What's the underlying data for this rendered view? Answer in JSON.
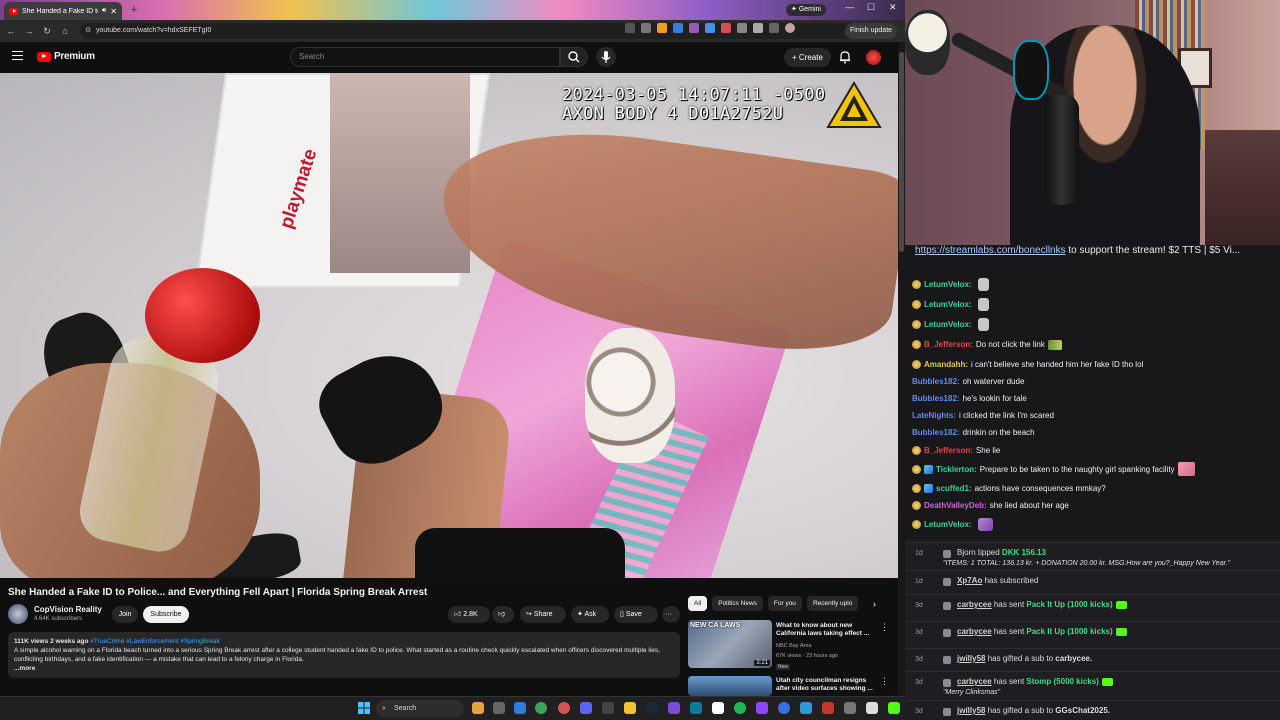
{
  "browser": {
    "tab_title": "She Handed a Fake ID to Po",
    "gemini_label": "Gemini",
    "url": "youtube.com/watch?v=hdxSEFETgI0",
    "finish_update_label": "Finish update"
  },
  "youtube": {
    "logo_text": "Premium",
    "search_placeholder": "Search",
    "create_label": "Create",
    "bodycam_timestamp": "2024-03-05 14:07:11 -0500",
    "bodycam_device": "AXON BODY 4 D01A2752U",
    "cooler_brand": "playmate",
    "video_title": "She Handed a Fake ID to Police... and Everything Fell Apart | Florida Spring Break Arrest",
    "channel_name": "CopVision Reality",
    "channel_subs": "4.64K subscribers",
    "join_label": "Join",
    "subscribe_label": "Subscribe",
    "like_count": "2.8K",
    "share_label": "Share",
    "ask_label": "Ask",
    "save_label": "Save",
    "more_actions": "···",
    "description": {
      "meta": "111K views  2 weeks ago ",
      "tags": "#TrueCrime #LawEnforcement #SpringBreak",
      "body": "A simple alcohol warning on a Florida beach turned into a serious Spring Break arrest after a college student handed a fake ID to police. What started as a routine check quickly escalated when officers discovered multiple lies, conflicting birthdays, and a fake identification — a mistake that can lead to a felony charge in Florida.",
      "more": "...more"
    },
    "chips": [
      "All",
      "Politics News",
      "For you",
      "Recently uplo"
    ],
    "recommended": [
      {
        "thumb_text": "NEW CA LAWS",
        "duration": "3:21",
        "title": "What to know about new California laws taking effect ...",
        "channel": "NBC Bay Area",
        "stats": "67K views · 23 hours ago",
        "badge": "New"
      },
      {
        "title": "Utah city councilman resigns after video surfaces showing ..."
      }
    ]
  },
  "chat": {
    "pinned_link": "https://streamlabs.com/bonecllnks",
    "pinned_rest": " to support the stream! $2 TTS | $5 Vi...",
    "messages": [
      {
        "user": "LetumVelox:",
        "text": "",
        "color": "#34d399",
        "badge": "gold",
        "emote": "plain"
      },
      {
        "user": "LetumVelox:",
        "text": "",
        "color": "#34d399",
        "badge": "gold",
        "emote": "plain"
      },
      {
        "user": "LetumVelox:",
        "text": "",
        "color": "#34d399",
        "badge": "gold",
        "emote": "plain"
      },
      {
        "user": "B_Jefferson:",
        "text": "Do not click the link",
        "color": "#e0464b",
        "badge": "gold",
        "emote": "green"
      },
      {
        "user": "Amandahh:",
        "text": "i can't believe she handed him her fake ID tho lol",
        "color": "#e6c84a",
        "badge": "gold",
        "emote": ""
      },
      {
        "user": "Bubbles182:",
        "text": "oh waterver dude",
        "color": "#5b8cf0",
        "badge": "",
        "emote": ""
      },
      {
        "user": "Bubbles182:",
        "text": "he's lookin for tale",
        "color": "#5b8cf0",
        "badge": "",
        "emote": ""
      },
      {
        "user": "LateNights:",
        "text": "i clicked the link I'm scared",
        "color": "#5b8cf0",
        "badge": "",
        "emote": ""
      },
      {
        "user": "Bubbles182:",
        "text": "drinkin on the beach",
        "color": "#5b8cf0",
        "badge": "",
        "emote": ""
      },
      {
        "user": "B_Jefferson:",
        "text": "She lie",
        "color": "#e0464b",
        "badge": "gold",
        "emote": ""
      },
      {
        "user": "Ticklerton:",
        "text": "Prepare to be taken to the naughty girl spanking facility",
        "color": "#34d399",
        "badge": "gold+blue",
        "emote": "pink"
      },
      {
        "user": "scuffed1:",
        "text": "actions have consequences mmkay?",
        "color": "#34d399",
        "badge": "gold+blue",
        "emote": ""
      },
      {
        "user": "DeathValleyDeb:",
        "text": "she lied about her age",
        "color": "#c26bd6",
        "badge": "gold",
        "emote": ""
      },
      {
        "user": "LetumVelox:",
        "text": "",
        "color": "#34d399",
        "badge": "gold",
        "emote": "purple"
      }
    ]
  },
  "feed": [
    {
      "time": "1d",
      "pre": "Bjorn tipped ",
      "highlight": "DKK 156.13",
      "post": "",
      "sub": "\"ITEMS: 1 TOTAL: 136.13 kr. + DONATION 20.00 kr. MSG:How are you?_Happy New Year.\""
    },
    {
      "time": "1d",
      "user": "Xp7Ao",
      "post": " has subscribed"
    },
    {
      "time": "3d",
      "user": "carbycee",
      "post": " has sent ",
      "highlight": "Pack It Up (1000 kicks)",
      "kick": true
    },
    {
      "time": "3d",
      "user": "carbycee",
      "post": " has sent ",
      "highlight": "Pack It Up (1000 kicks)",
      "kick": true
    },
    {
      "time": "3d",
      "user": "jwilly58",
      "post": " has gifted a sub to ",
      "bold": "carbycee."
    },
    {
      "time": "3d",
      "user": "carbycee",
      "post": " has sent ",
      "highlight": "Stomp (5000 kicks)",
      "kick": true,
      "sub": "\"Merry Clinksmas\""
    },
    {
      "time": "3d",
      "user": "jwilly58",
      "post": " has gifted a sub to ",
      "bold": "GGsChat2025."
    }
  ],
  "taskbar": {
    "search_label": "Search"
  },
  "colors": {
    "youtube_red": "#ff0000",
    "link_blue": "#3ea6ff",
    "kick_green": "#53fc18"
  }
}
